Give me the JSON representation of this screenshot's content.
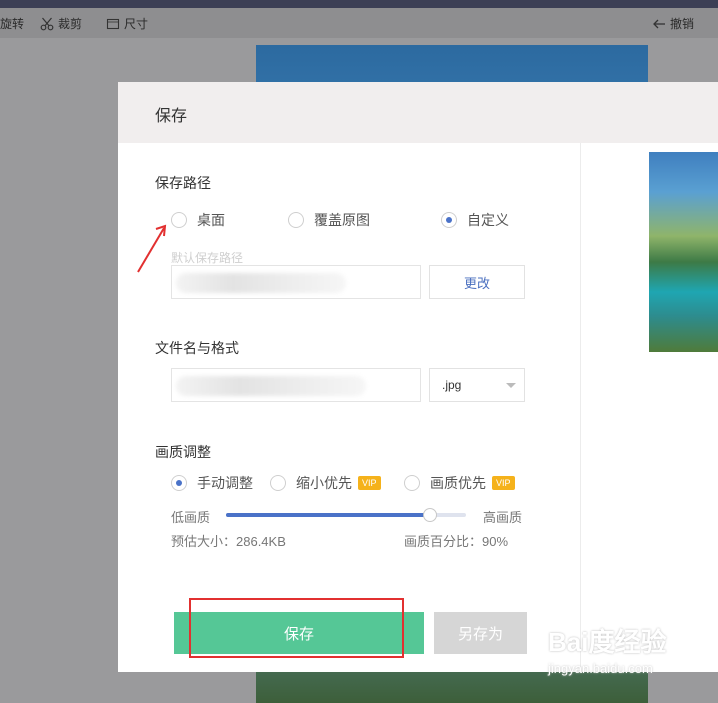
{
  "toolbar": {
    "rotate_label": "旋转",
    "crop_label": "裁剪",
    "size_label": "尺寸",
    "undo_label": "撤销",
    "icons": [
      "scissors-icon",
      "size-icon",
      "arrow-left-icon"
    ]
  },
  "dialog": {
    "title": "保存",
    "save_path": {
      "label": "保存路径",
      "options": [
        {
          "label": "桌面",
          "selected": false
        },
        {
          "label": "覆盖原图",
          "selected": false
        },
        {
          "label": "自定义",
          "selected": true
        }
      ],
      "hint": "默认保存路径",
      "change_button": "更改"
    },
    "filename": {
      "label": "文件名与格式",
      "format": ".jpg"
    },
    "quality": {
      "label": "画质调整",
      "options": [
        {
          "label": "手动调整",
          "selected": true,
          "vip": false
        },
        {
          "label": "缩小优先",
          "selected": false,
          "vip": true
        },
        {
          "label": "画质优先",
          "selected": false,
          "vip": true
        }
      ],
      "vip_badge": "VIP",
      "low_label": "低画质",
      "high_label": "高画质",
      "slider_value": 0.85,
      "estimated_size": "预估大小：286.4KB",
      "percent": "画质百分比：90%"
    },
    "buttons": {
      "save": "保存",
      "save_as": "另存为"
    }
  },
  "watermark": {
    "logo": "Bai度经验",
    "url": "jingyan.baidu.com"
  },
  "colors": {
    "accent_blue": "#4a72c8",
    "save_green": "#55c796",
    "annotation_red": "#e23030",
    "vip_yellow": "#f5b21b"
  }
}
